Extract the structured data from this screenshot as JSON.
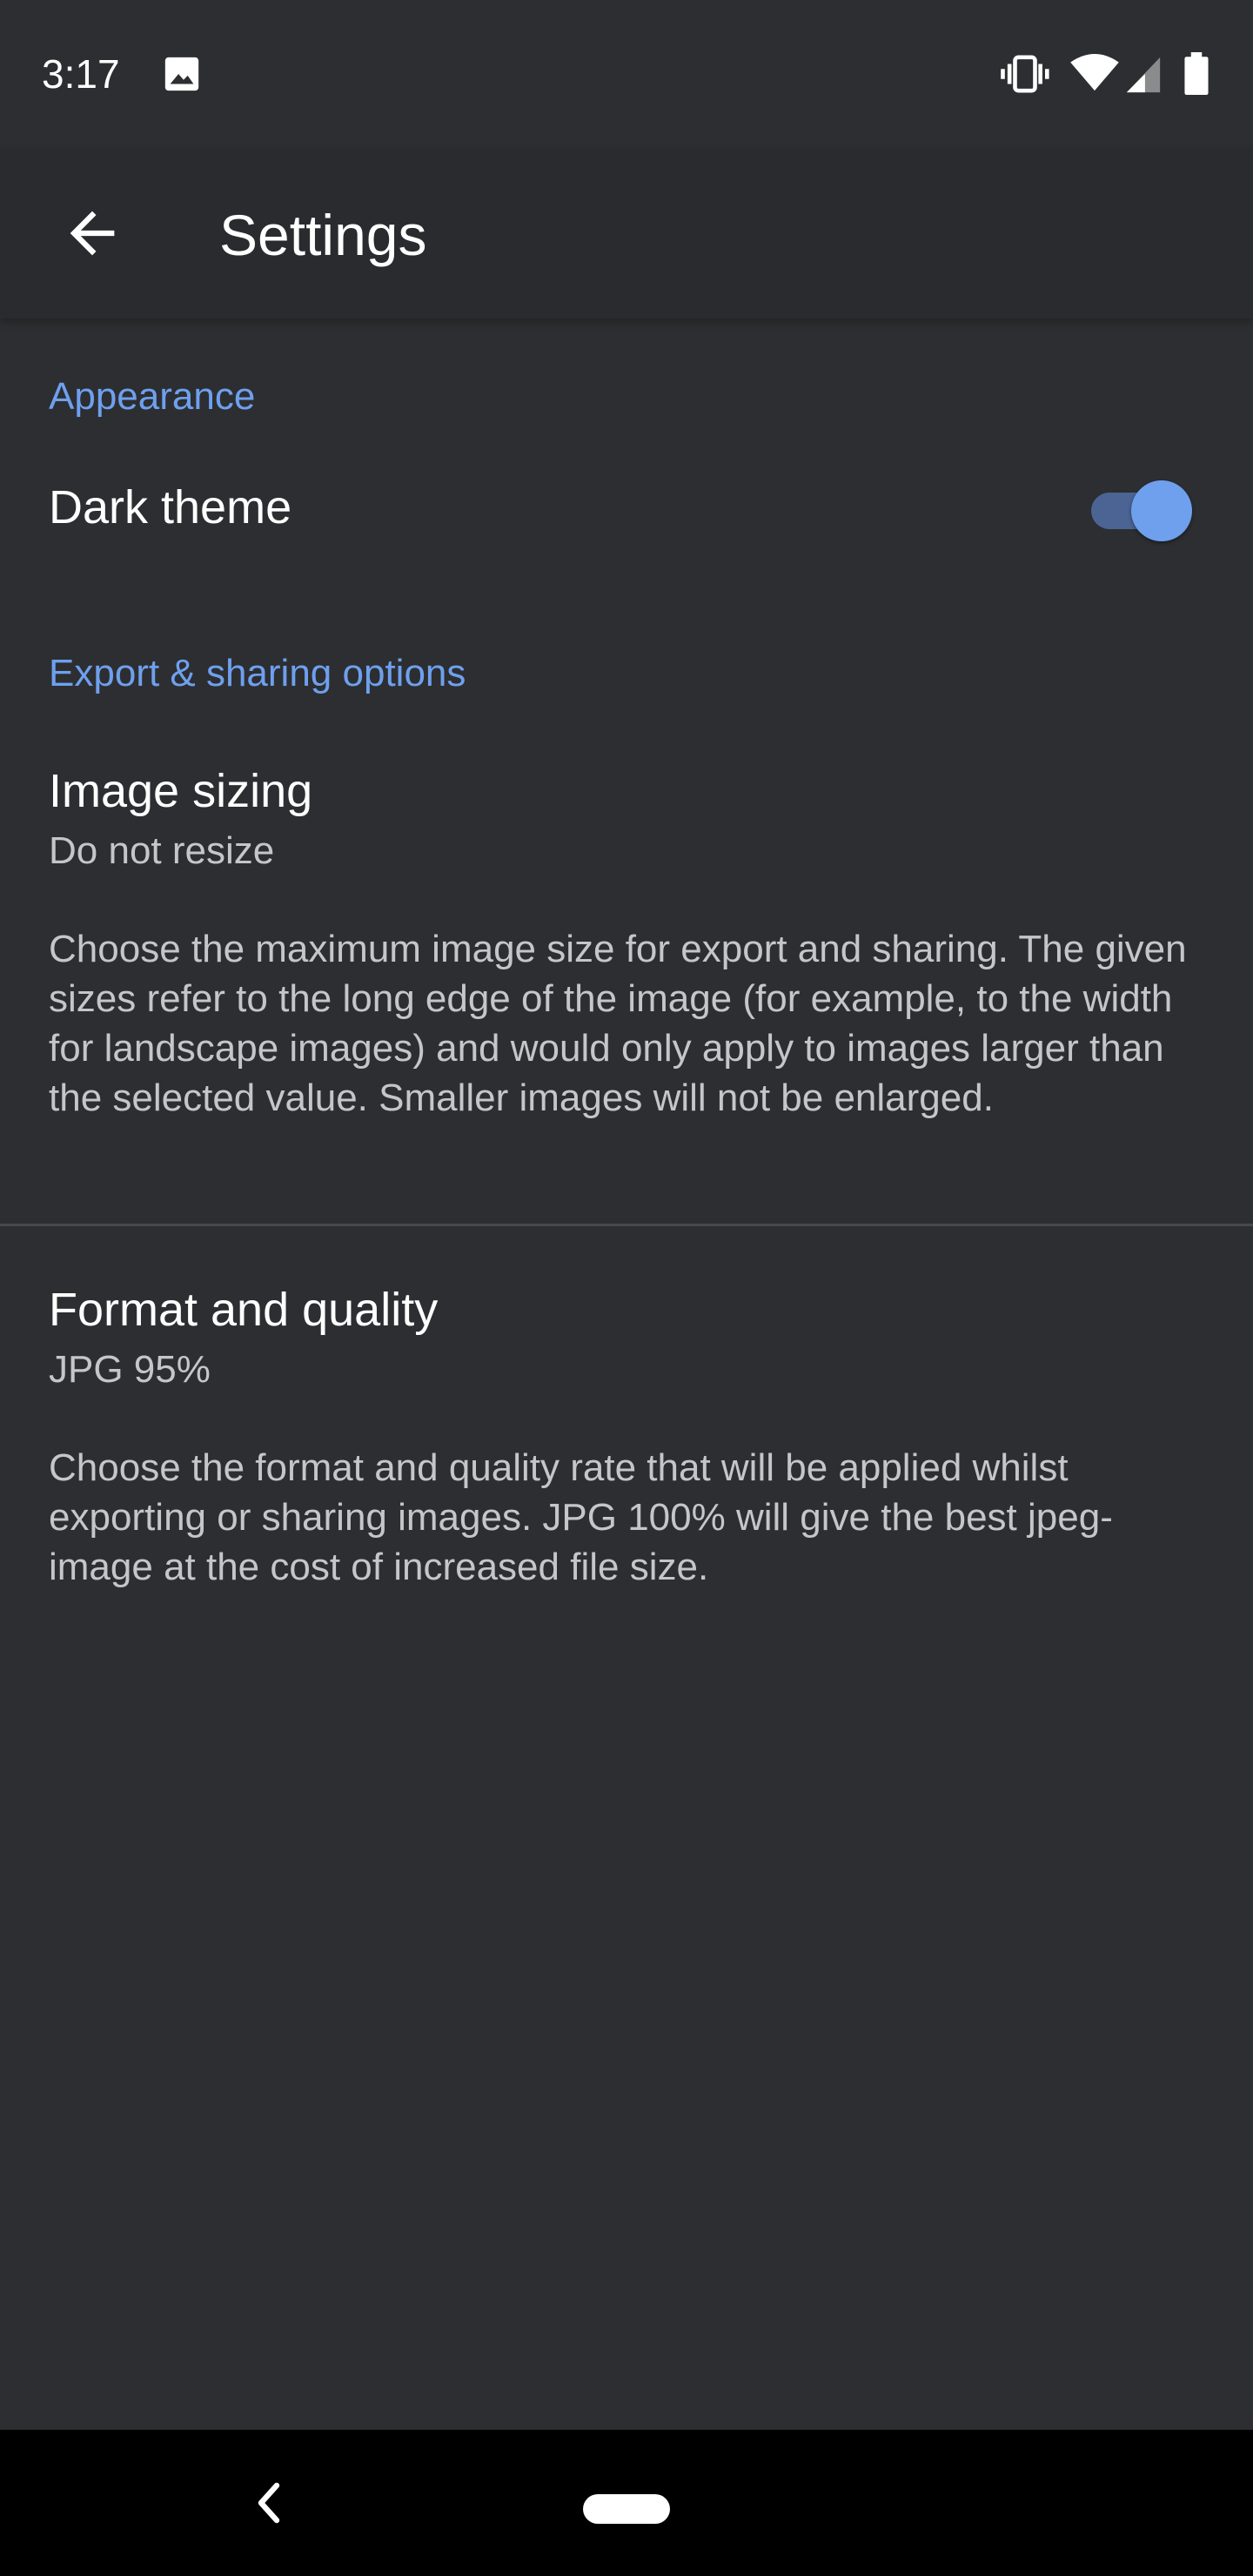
{
  "status_bar": {
    "time": "3:17",
    "icons": [
      "gallery-icon",
      "vibrate-icon",
      "wifi-icon",
      "signal-icon",
      "battery-icon"
    ]
  },
  "app_bar": {
    "back_icon": "arrow-back-icon",
    "title": "Settings"
  },
  "sections": {
    "appearance": {
      "header": "Appearance",
      "dark_theme": {
        "title": "Dark theme",
        "enabled": true
      }
    },
    "export": {
      "header": "Export & sharing options",
      "image_sizing": {
        "title": "Image sizing",
        "summary": "Do not resize",
        "description": "Choose the maximum image size for export and sharing. The given sizes refer to the long edge of the image (for example, to the width for landscape images) and would only apply to images larger than the selected value. Smaller images will not be enlarged."
      },
      "format_quality": {
        "title": "Format and quality",
        "summary": "JPG 95%",
        "description": "Choose the format and quality rate that will be applied whilst exporting or sharing images. JPG 100% will give the best jpeg-image at the cost of increased file size."
      }
    }
  },
  "nav_bar": {
    "back_icon": "nav-back-icon",
    "home_icon": "home-pill-icon"
  },
  "colors": {
    "background": "#2d2e31",
    "accent": "#6ea0ee",
    "toggle_track": "#4b6494",
    "text_secondary": "#c4c6c9"
  }
}
